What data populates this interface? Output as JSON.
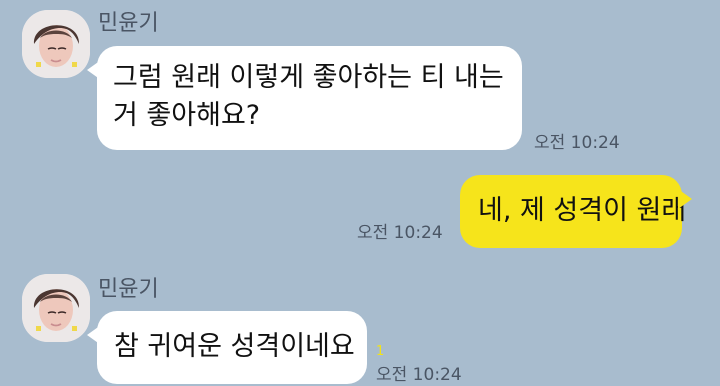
{
  "colors": {
    "chat_background": "#a8bcce",
    "incoming_bubble": "#ffffff",
    "outgoing_bubble": "#f6e41b",
    "unread_count": "#f3e316"
  },
  "messages": [
    {
      "sender": "민윤기",
      "avatar": "profile-photo",
      "lines": [
        "그럼 원래 이렇게 좋아하는 티 내는",
        "거 좋아해요?"
      ],
      "time": "오전 10:24"
    },
    {
      "mine": true,
      "lines": [
        "네, 제 성격이 원래"
      ],
      "time": "오전 10:24"
    },
    {
      "sender": "민윤기",
      "avatar": "profile-photo",
      "lines": [
        "참 귀여운 성격이네요"
      ],
      "unread": "1",
      "time": "오전 10:24"
    }
  ]
}
